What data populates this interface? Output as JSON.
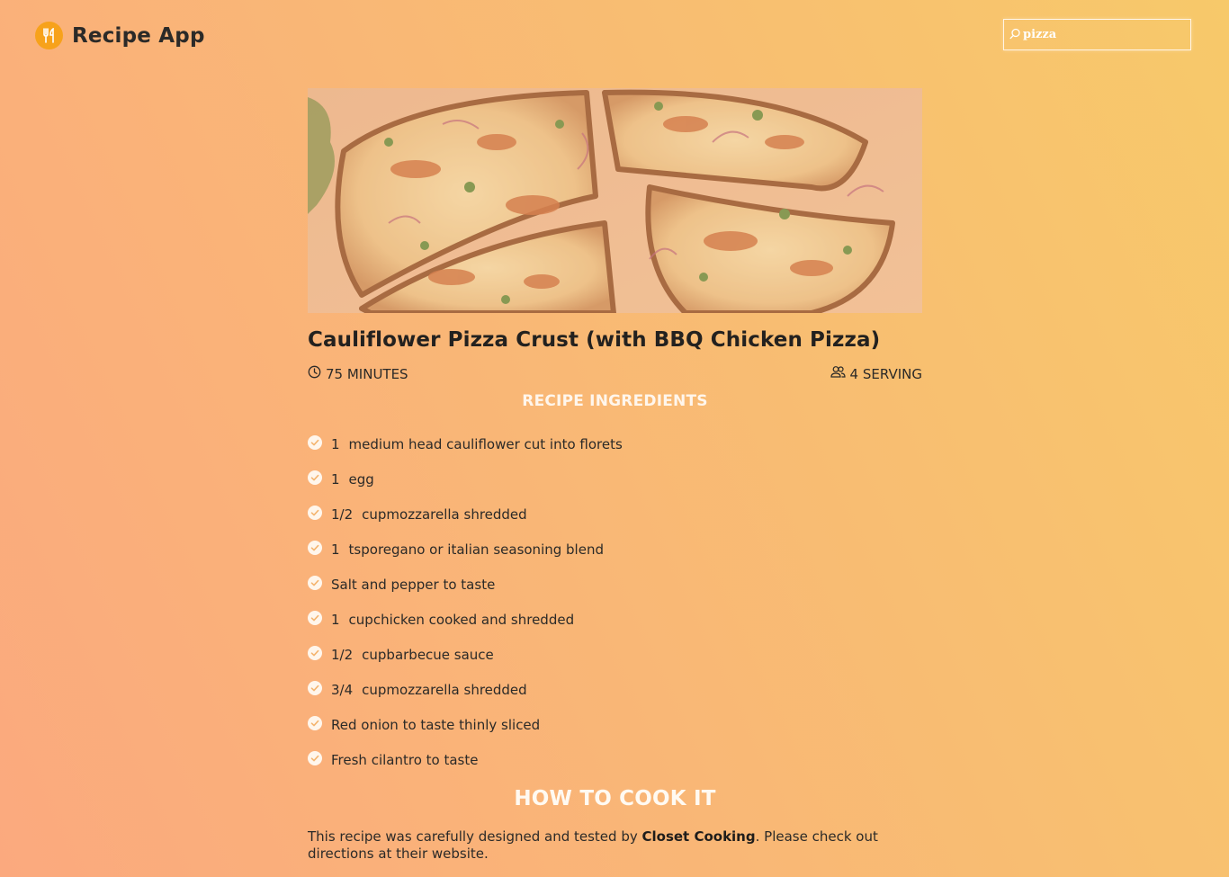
{
  "header": {
    "app_name": "Recipe App",
    "search_value": "pizza"
  },
  "recipe": {
    "title": "Cauliflower Pizza Crust (with BBQ Chicken Pizza)",
    "time": "75 MINUTES",
    "servings": "4 SERVING",
    "ingredients_heading": "RECIPE INGREDIENTS",
    "ingredients": [
      {
        "qty": "1",
        "text": "medium head cauliflower cut into florets"
      },
      {
        "qty": "1",
        "text": "egg"
      },
      {
        "qty": "1/2",
        "text": "cupmozzarella shredded"
      },
      {
        "qty": "1",
        "text": "tsporegano or italian seasoning blend"
      },
      {
        "qty": "",
        "text": "Salt and pepper to taste"
      },
      {
        "qty": "1",
        "text": "cupchicken cooked and shredded"
      },
      {
        "qty": "1/2",
        "text": "cupbarbecue sauce"
      },
      {
        "qty": "3/4",
        "text": "cupmozzarella shredded"
      },
      {
        "qty": "",
        "text": "Red onion to taste thinly sliced"
      },
      {
        "qty": "",
        "text": "Fresh cilantro to taste"
      }
    ],
    "how_heading": "HOW TO COOK IT",
    "note_before": "This recipe was carefully designed and tested by ",
    "note_source": "Closet Cooking",
    "note_after": ". Please check out directions at their website."
  },
  "colors": {
    "accent": "#f7a21b",
    "check": "#fff6ec",
    "text": "#2b2a28"
  }
}
